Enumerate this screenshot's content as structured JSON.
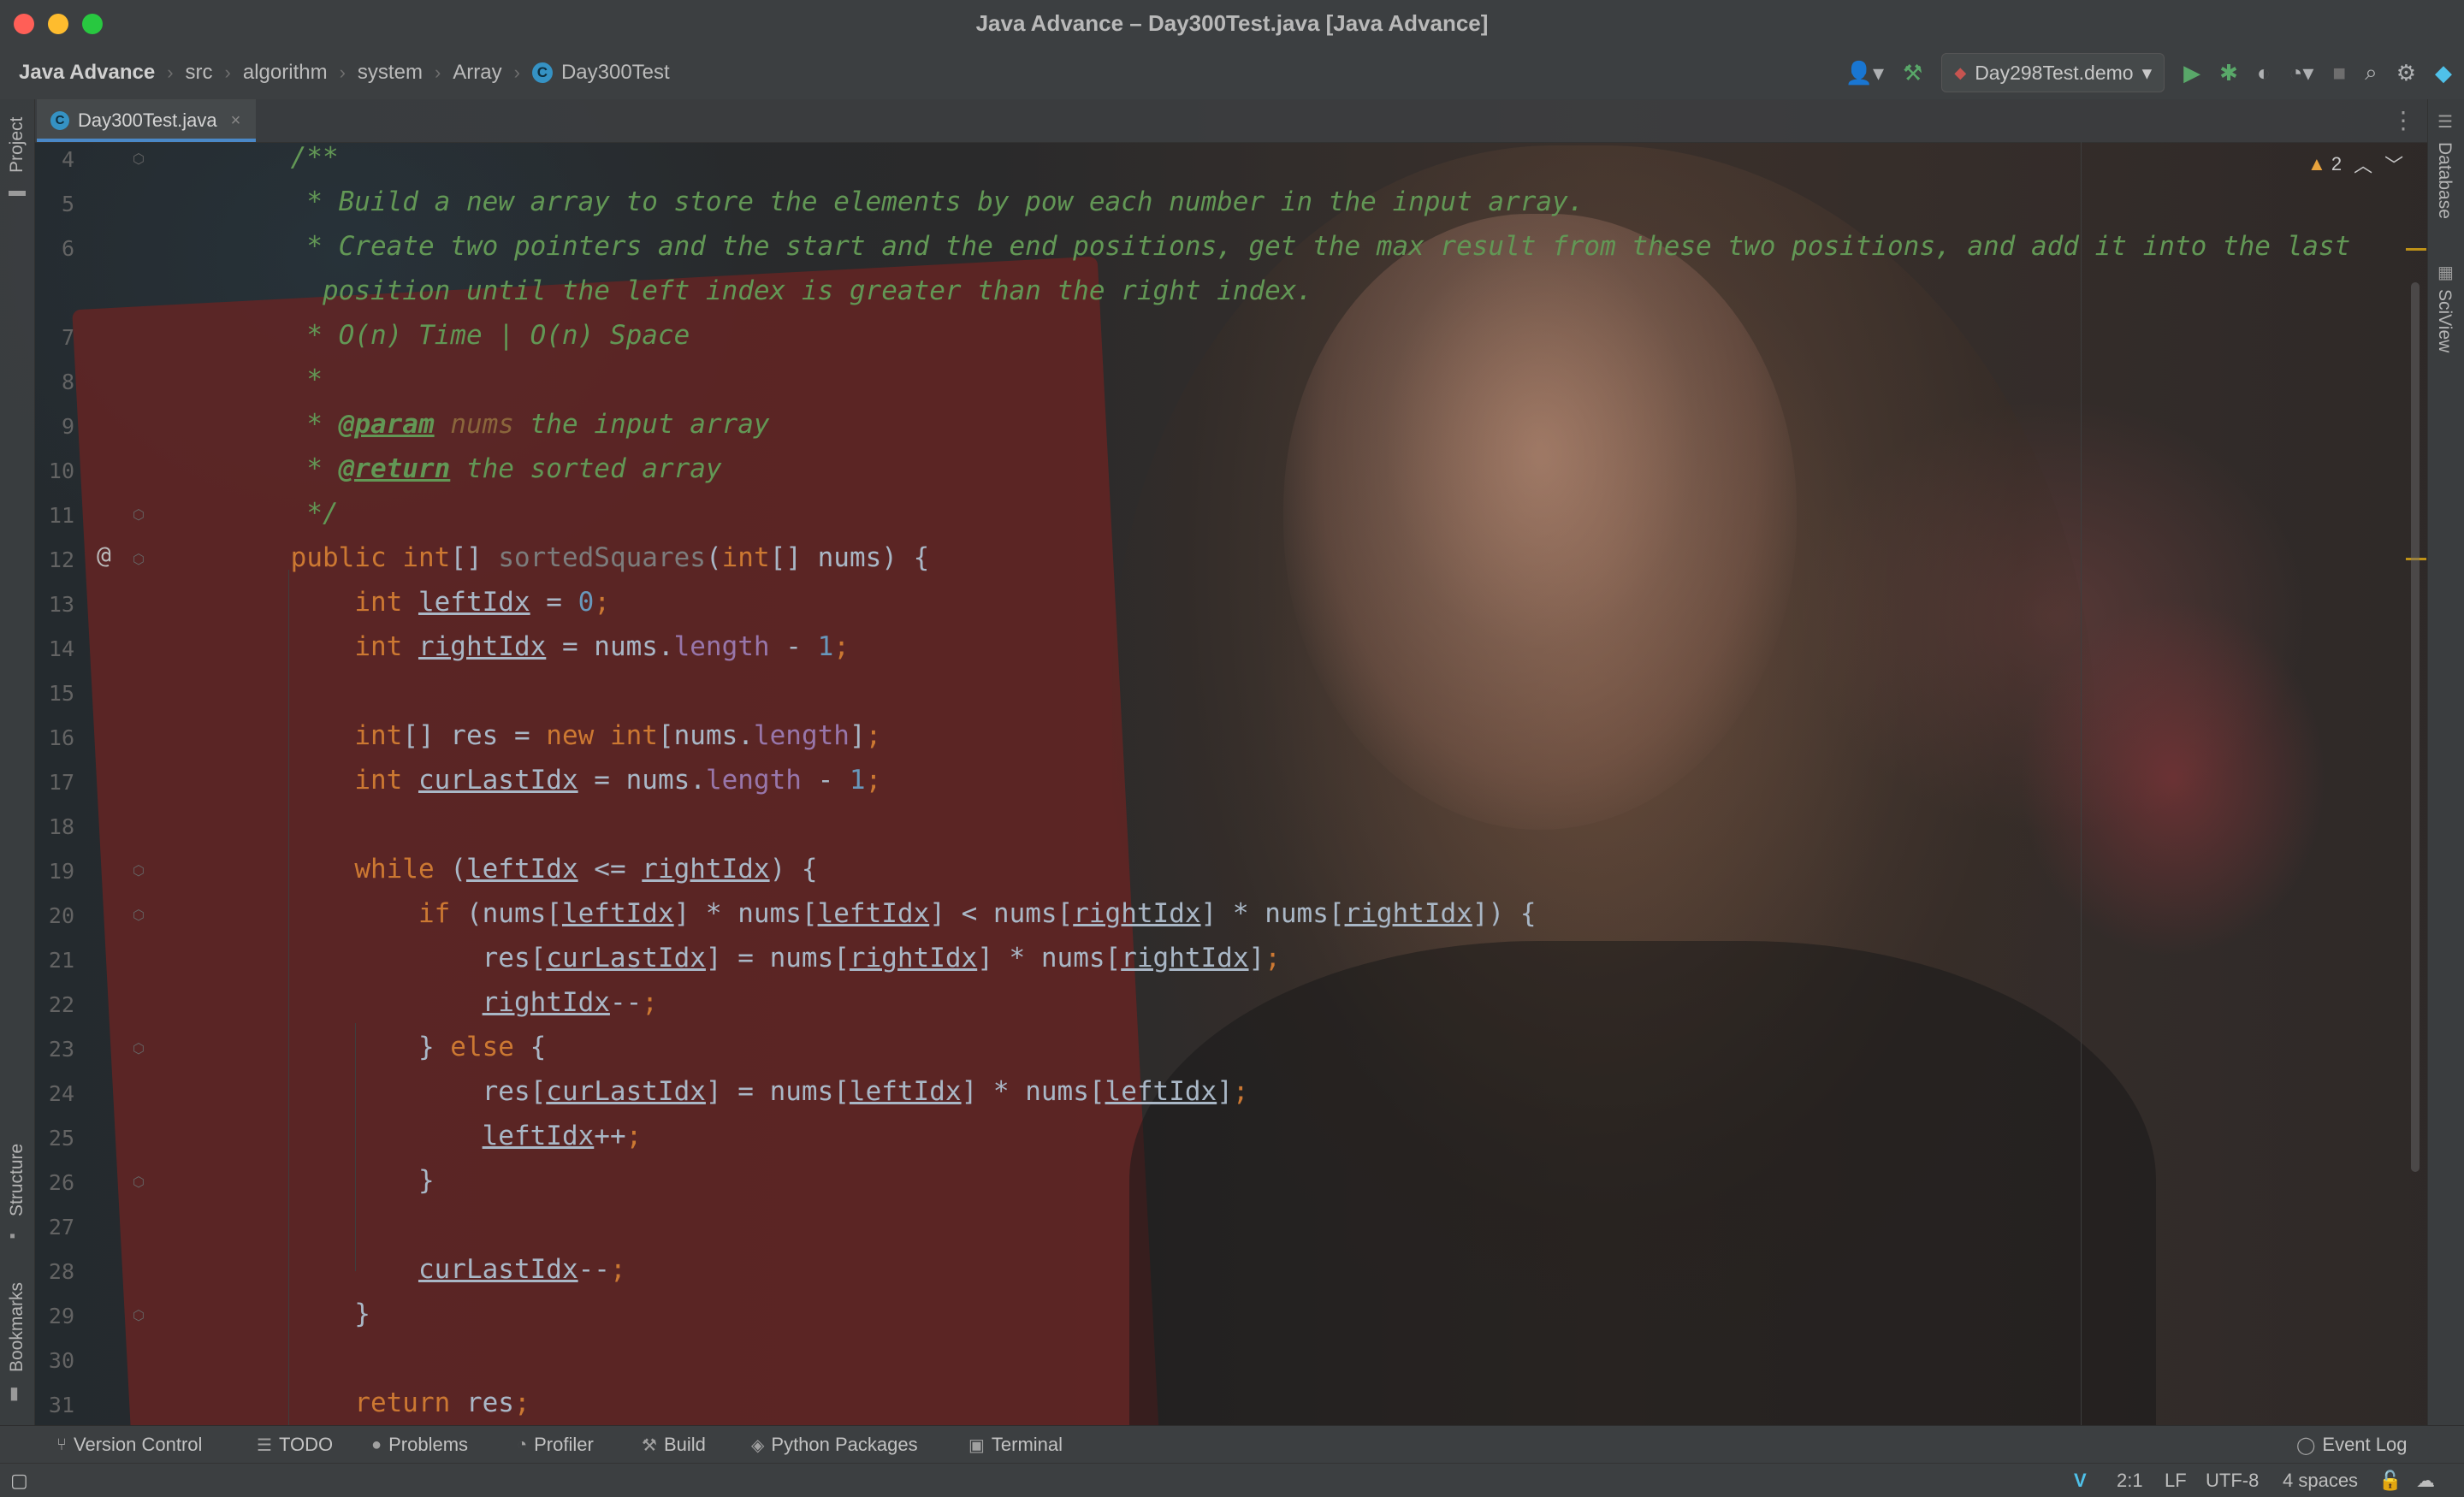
{
  "window": {
    "title": "Java Advance – Day300Test.java [Java Advance]"
  },
  "breadcrumb": {
    "items": [
      "Java Advance",
      "src",
      "algorithm",
      "system",
      "Array",
      "Day300Test"
    ]
  },
  "toolbar": {
    "run_config": "Day298Test.demo"
  },
  "left_strip": {
    "project": "Project",
    "structure": "Structure",
    "bookmarks": "Bookmarks"
  },
  "right_strip": {
    "database": "Database",
    "sciview": "SciView"
  },
  "tab": {
    "label": "Day300Test.java"
  },
  "inspection": {
    "warnings": "2"
  },
  "line_numbers": [
    "4",
    "5",
    "6",
    "",
    "7",
    "8",
    "9",
    "10",
    "11",
    "12",
    "13",
    "14",
    "15",
    "16",
    "17",
    "18",
    "19",
    "20",
    "21",
    "22",
    "23",
    "24",
    "25",
    "26",
    "27",
    "28",
    "29",
    "30",
    "31"
  ],
  "code_lines": [
    "    /**",
    "     * Build a new array to store the elements by pow each number in the input array.",
    "     * Create two pointers and the start and the end positions, get the max result from these two positions, and add it into the last",
    "      position until the left index is greater than the right index.",
    "     * O(n) Time | O(n) Space",
    "     *",
    "     * @param nums the input array",
    "     * @return the sorted array",
    "     */",
    "    public int[] sortedSquares(int[] nums) {",
    "        int leftIdx = 0;",
    "        int rightIdx = nums.length - 1;",
    "",
    "        int[] res = new int[nums.length];",
    "        int curLastIdx = nums.length - 1;",
    "",
    "        while (leftIdx <= rightIdx) {",
    "            if (nums[leftIdx] * nums[leftIdx] < nums[rightIdx] * nums[rightIdx]) {",
    "                res[curLastIdx] = nums[rightIdx] * nums[rightIdx];",
    "                rightIdx--;",
    "            } else {",
    "                res[curLastIdx] = nums[leftIdx] * nums[leftIdx];",
    "                leftIdx++;",
    "            }",
    "",
    "            curLastIdx--;",
    "        }",
    "",
    "        return res;"
  ],
  "bottom_tools": [
    "Version Control",
    "TODO",
    "Problems",
    "Profiler",
    "Build",
    "Python Packages",
    "Terminal"
  ],
  "event_log": "Event Log",
  "status": {
    "position": "2:1",
    "line_sep": "LF",
    "encoding": "UTF-8",
    "indent": "4 spaces"
  },
  "colors": {
    "keyword": "#cc7832",
    "comment": "#629755",
    "number": "#6897bb",
    "field": "#9876aa",
    "text": "#a9b7c6",
    "accent": "#4a88c7"
  },
  "icons": [
    "git-user-icon",
    "hammer-icon",
    "run-icon",
    "debug-icon",
    "coverage-icon",
    "profile-icon",
    "stop-icon",
    "search-icon",
    "settings-icon",
    "plugin-icon"
  ]
}
